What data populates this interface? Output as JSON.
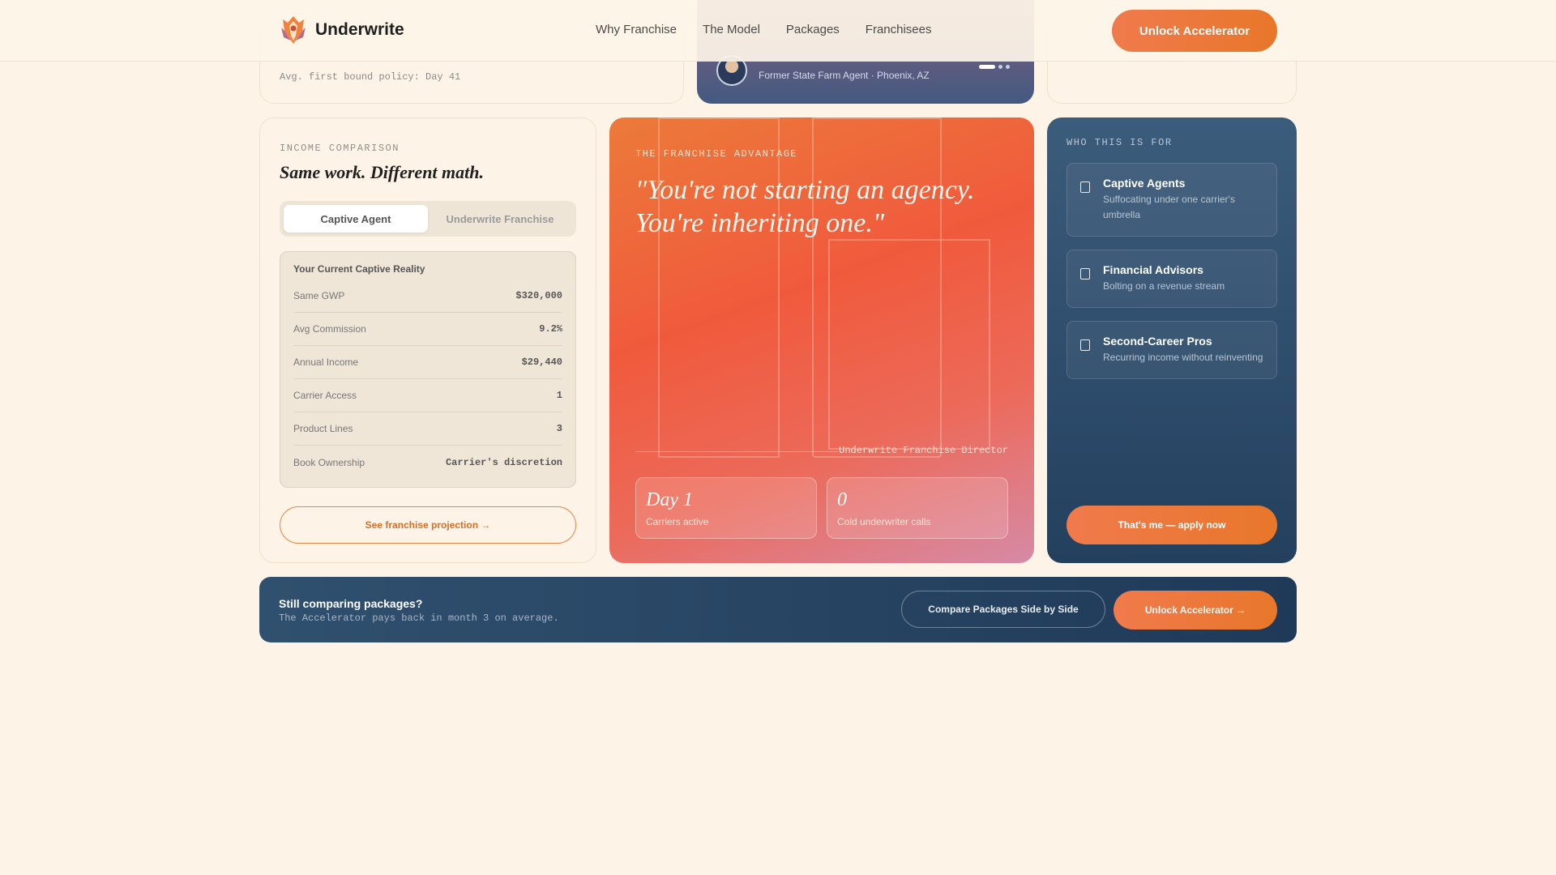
{
  "nav": {
    "brand": "Underwrite",
    "links": [
      "Why Franchise",
      "The Model",
      "Packages",
      "Franchisees"
    ],
    "cta": "Unlock Accelerator"
  },
  "top_left": {
    "subtext": "Avg. first bound policy: Day 41"
  },
  "testimonial": {
    "role": "Former State Farm Agent · Phoenix, AZ",
    "slides": 3,
    "active_slide": 1
  },
  "income": {
    "eyebrow": "INCOME COMPARISON",
    "title": "Same work. Different math.",
    "tabs": [
      "Captive Agent",
      "Underwrite Franchise"
    ],
    "active_tab": "Captive Agent",
    "panel_title": "Your Current Captive Reality",
    "rows": [
      {
        "label": "Same GWP",
        "value": "$320,000"
      },
      {
        "label": "Avg Commission",
        "value": "9.2%"
      },
      {
        "label": "Annual Income",
        "value": "$29,440"
      },
      {
        "label": "Carrier Access",
        "value": "1"
      },
      {
        "label": "Product Lines",
        "value": "3"
      },
      {
        "label": "Book Ownership",
        "value": "Carrier's discretion"
      }
    ],
    "button": "See franchise projection →"
  },
  "advantage": {
    "eyebrow": "THE FRANCHISE ADVANTAGE",
    "quote": "\"You're not starting an agency. You're inheriting one.\"",
    "attribution": "Underwrite Franchise Director",
    "stats": [
      {
        "value": "Day 1",
        "label": "Carriers active"
      },
      {
        "value": "0",
        "label": "Cold underwriter calls"
      }
    ]
  },
  "who": {
    "eyebrow": "WHO THIS IS FOR",
    "personas": [
      {
        "title": "Captive Agents",
        "desc": "Suffocating under one carrier's umbrella"
      },
      {
        "title": "Financial Advisors",
        "desc": "Bolting on a revenue stream"
      },
      {
        "title": "Second-Career Pros",
        "desc": "Recurring income without reinventing"
      }
    ],
    "button": "That's me — apply now"
  },
  "banner": {
    "title": "Still comparing packages?",
    "subtitle": "The Accelerator pays back in month 3 on average.",
    "compare_button": "Compare Packages Side by Side",
    "cta": "Unlock Accelerator →"
  },
  "colors": {
    "accent": "#f07a4c",
    "navy": "#23405e",
    "cream": "#fdf4e7"
  }
}
